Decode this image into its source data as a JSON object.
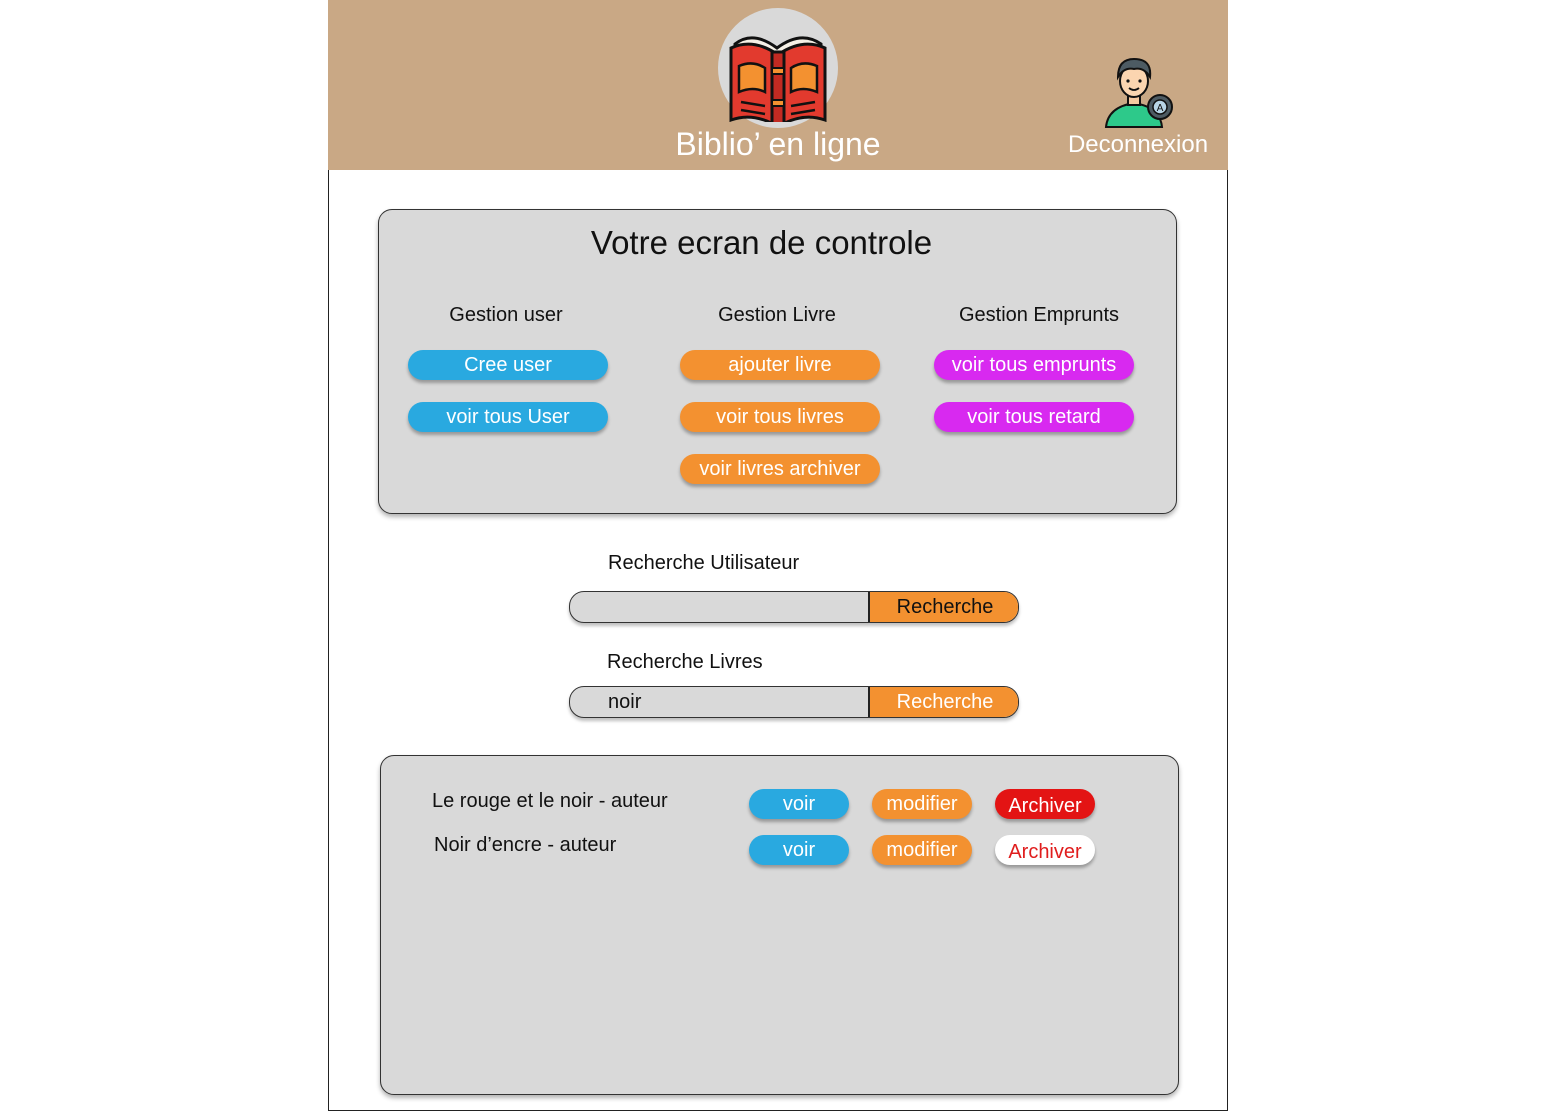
{
  "header": {
    "site_title": "Biblio’ en ligne",
    "logout_label": "Deconnexion",
    "background": "#c9a885"
  },
  "control_panel": {
    "title": "Votre ecran de controle",
    "columns": [
      {
        "heading": "Gestion user",
        "buttons": [
          "Cree user",
          "voir tous User"
        ],
        "color": "#29a9e0"
      },
      {
        "heading": "Gestion Livre",
        "buttons": [
          "ajouter livre",
          "voir tous livres",
          "voir livres archiver"
        ],
        "color": "#f39130"
      },
      {
        "heading": "Gestion Emprunts",
        "buttons": [
          "voir tous emprunts",
          "voir tous retard"
        ],
        "color": "#d829f0"
      }
    ]
  },
  "search_user": {
    "label": "Recherche Utilisateur",
    "value": "",
    "button_label": "Recherche"
  },
  "search_books": {
    "label": "Recherche Livres",
    "value": "noir",
    "button_label": "Recherche"
  },
  "results": [
    {
      "title": "Le rouge et le noir - auteur",
      "view_label": "voir",
      "edit_label": "modifier",
      "archive_label": "Archiver"
    },
    {
      "title": "Noir d’encre - auteur",
      "view_label": "voir",
      "edit_label": "modifier",
      "archive_label": "Archiver"
    }
  ]
}
